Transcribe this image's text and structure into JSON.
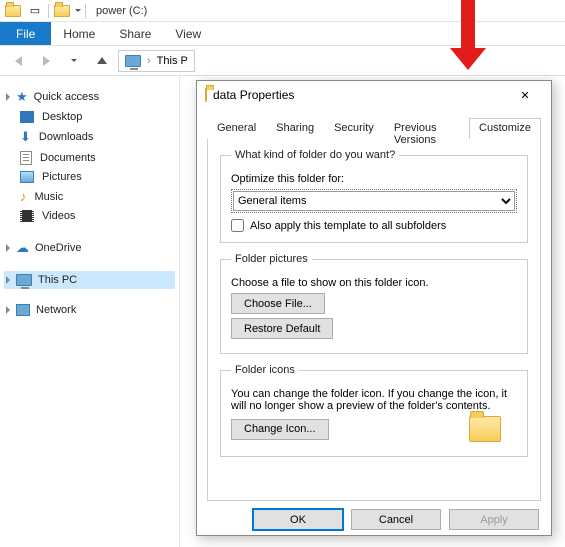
{
  "window": {
    "title": "power (C:)"
  },
  "ribbon": {
    "file": "File",
    "home": "Home",
    "share": "Share",
    "view": "View"
  },
  "breadcrumb": {
    "root": "This P"
  },
  "sidebar": {
    "quick": "Quick access",
    "items": [
      "Desktop",
      "Downloads",
      "Documents",
      "Pictures",
      "Music",
      "Videos"
    ],
    "onedrive": "OneDrive",
    "thispc": "This PC",
    "network": "Network"
  },
  "dialog": {
    "title": "data Properties",
    "tabs": [
      "General",
      "Sharing",
      "Security",
      "Previous Versions",
      "Customize"
    ],
    "group1": {
      "legend": "What kind of folder do you want?",
      "label": "Optimize this folder for:",
      "value": "General items",
      "check": "Also apply this template to all subfolders"
    },
    "group2": {
      "legend": "Folder pictures",
      "desc": "Choose a file to show on this folder icon.",
      "choose": "Choose File...",
      "restore": "Restore Default"
    },
    "group3": {
      "legend": "Folder icons",
      "desc": "You can change the folder icon. If you change the icon, it will no longer show a preview of the folder's contents.",
      "change": "Change Icon..."
    },
    "buttons": {
      "ok": "OK",
      "cancel": "Cancel",
      "apply": "Apply"
    }
  }
}
